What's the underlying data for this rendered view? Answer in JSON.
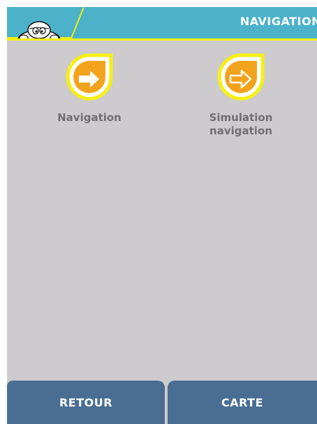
{
  "header": {
    "title": "NAVIGATION",
    "logo_icon": "michelin-bibendum-icon",
    "background_color": "#4bb2ca",
    "accent_color": "#f2ef12"
  },
  "menu": {
    "items": [
      {
        "label": "Navigation",
        "icon": "arrow-right-icon"
      },
      {
        "label": "Simulation\nnavigation",
        "icon": "outlined-arrow-right-icon"
      }
    ]
  },
  "footer": {
    "back_label": "RETOUR",
    "map_label": "CARTE",
    "button_color": "#4a6e93"
  },
  "colors": {
    "screen_background": "#cdcbcd",
    "icon_fill": "#f2a31b",
    "icon_ring": "#f5ef16",
    "label_text": "#6f6f6f"
  }
}
